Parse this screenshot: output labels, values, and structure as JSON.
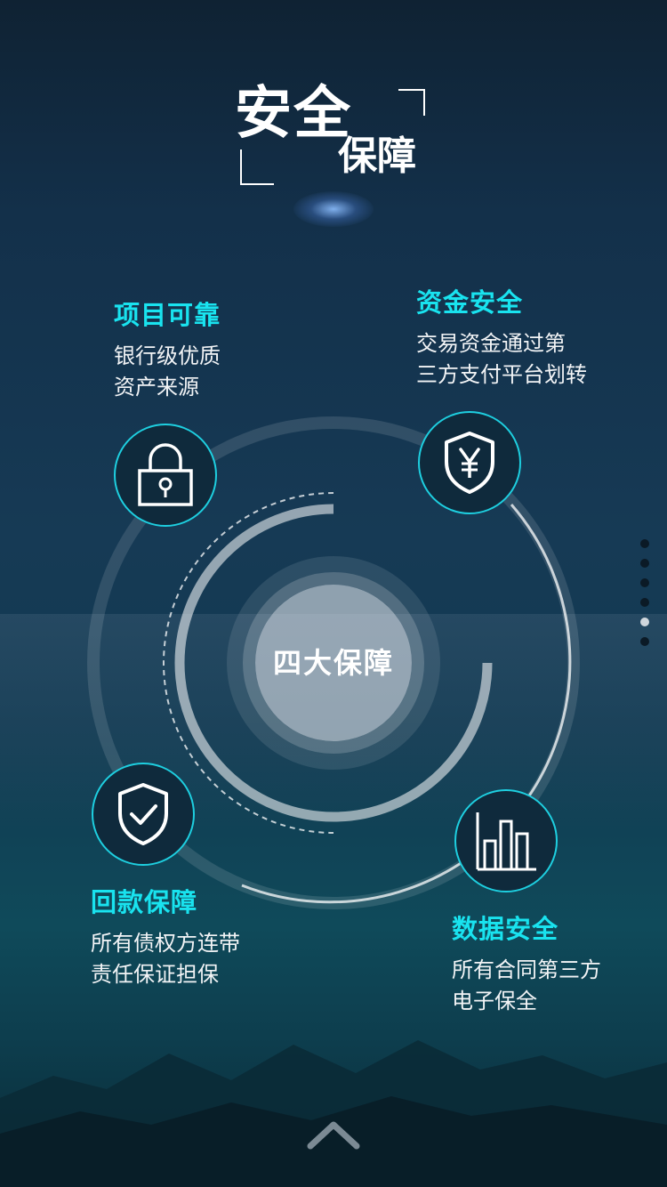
{
  "title": {
    "line1": "安全",
    "line2": "保障"
  },
  "center": {
    "label": "四大保障"
  },
  "features": {
    "project": {
      "title": "项目可靠",
      "line1": "银行级优质",
      "line2": "资产来源",
      "icon": "lock-icon"
    },
    "funds": {
      "title": "资金安全",
      "line1": "交易资金通过第",
      "line2": "三方支付平台划转",
      "icon": "yuan-shield-icon"
    },
    "repay": {
      "title": "回款保障",
      "line1": "所有债权方连带",
      "line2": "责任保证担保",
      "icon": "check-shield-icon"
    },
    "data": {
      "title": "数据安全",
      "line1": "所有合同第三方",
      "line2": "电子保全",
      "icon": "bar-chart-icon"
    }
  },
  "pagination": {
    "total": 6,
    "active_index": 4
  },
  "colors": {
    "accent": "#19e3ef",
    "icon_border": "#1ecfe0",
    "background_top": "#0f2233",
    "background_bottom": "#0a2a35"
  }
}
